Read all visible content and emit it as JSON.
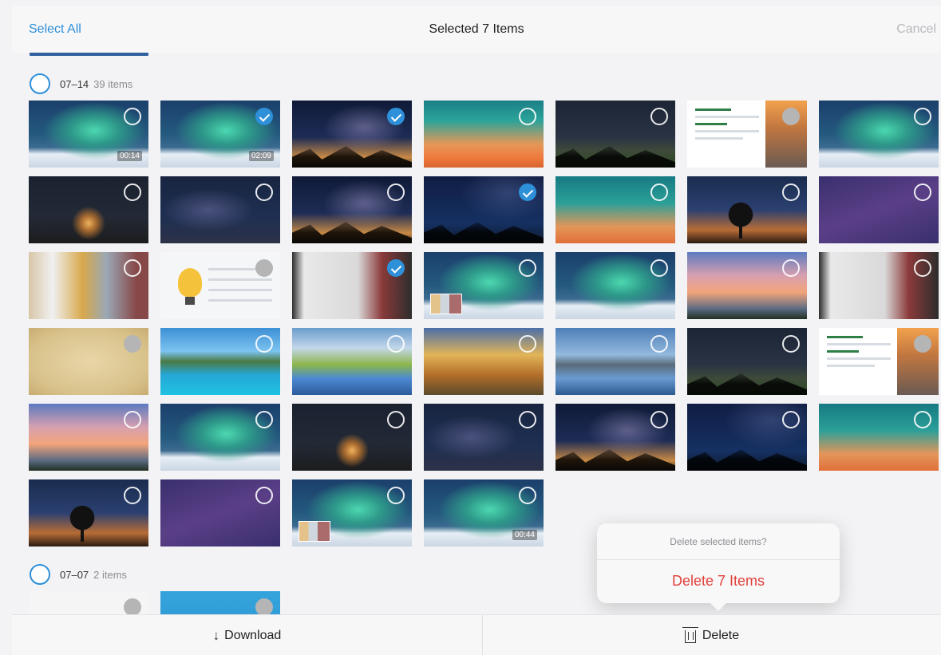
{
  "header": {
    "select_all_label": "Select All",
    "title": "Selected 7 Items",
    "cancel_label": "Cancel"
  },
  "sections": [
    {
      "date": "07–14",
      "count": "39 items"
    },
    {
      "date": "07–07",
      "count": "2 items"
    }
  ],
  "thumbnails": [
    {
      "kind": "aurora",
      "selected": false,
      "duration": "00:14"
    },
    {
      "kind": "aurora",
      "selected": true,
      "duration": "02:09"
    },
    {
      "kind": "milky",
      "selected": true
    },
    {
      "kind": "sunsetsky",
      "selected": false
    },
    {
      "kind": "nightcamp",
      "selected": false
    },
    {
      "kind": "slide",
      "selected": false
    },
    {
      "kind": "aurora",
      "selected": false
    },
    {
      "kind": "tentglow",
      "selected": false
    },
    {
      "kind": "starfield",
      "selected": false
    },
    {
      "kind": "milky",
      "selected": false
    },
    {
      "kind": "deepblue",
      "selected": true
    },
    {
      "kind": "tealsunset",
      "selected": false
    },
    {
      "kind": "treesunset",
      "selected": false
    },
    {
      "kind": "purple",
      "selected": false
    },
    {
      "kind": "people",
      "selected": false
    },
    {
      "kind": "bulb",
      "selected": false
    },
    {
      "kind": "webinar",
      "selected": true
    },
    {
      "kind": "aurora",
      "selected": false,
      "mini": true
    },
    {
      "kind": "aurora",
      "selected": false
    },
    {
      "kind": "pinksky",
      "selected": false
    },
    {
      "kind": "webinar",
      "selected": false
    },
    {
      "kind": "parchment",
      "selected": false
    },
    {
      "kind": "bungalow",
      "selected": false
    },
    {
      "kind": "alpine",
      "selected": false
    },
    {
      "kind": "lakesunset",
      "selected": false
    },
    {
      "kind": "lake",
      "selected": false
    },
    {
      "kind": "nightcamp",
      "selected": false
    },
    {
      "kind": "slide",
      "selected": false
    },
    {
      "kind": "pinksky",
      "selected": false
    },
    {
      "kind": "aurora",
      "selected": false
    },
    {
      "kind": "tentglow",
      "selected": false
    },
    {
      "kind": "starfield",
      "selected": false
    },
    {
      "kind": "milky",
      "selected": false
    },
    {
      "kind": "deepblue",
      "selected": false
    },
    {
      "kind": "tealsunset",
      "selected": false
    },
    {
      "kind": "treesunset",
      "selected": false
    },
    {
      "kind": "purple",
      "selected": false
    },
    {
      "kind": "aurora",
      "selected": false,
      "mini": true
    },
    {
      "kind": "aurora",
      "selected": false,
      "duration": "00:44"
    }
  ],
  "section2_thumbnails": [
    {
      "kind": "blank",
      "selected": false
    },
    {
      "kind": "chartthumb",
      "selected": false
    }
  ],
  "popover": {
    "message": "Delete selected items?",
    "confirm_label": "Delete 7 Items"
  },
  "toolbar": {
    "download_label": "Download",
    "delete_label": "Delete"
  },
  "colors": {
    "accent": "#2e90d9",
    "destructive": "#e0403a"
  }
}
